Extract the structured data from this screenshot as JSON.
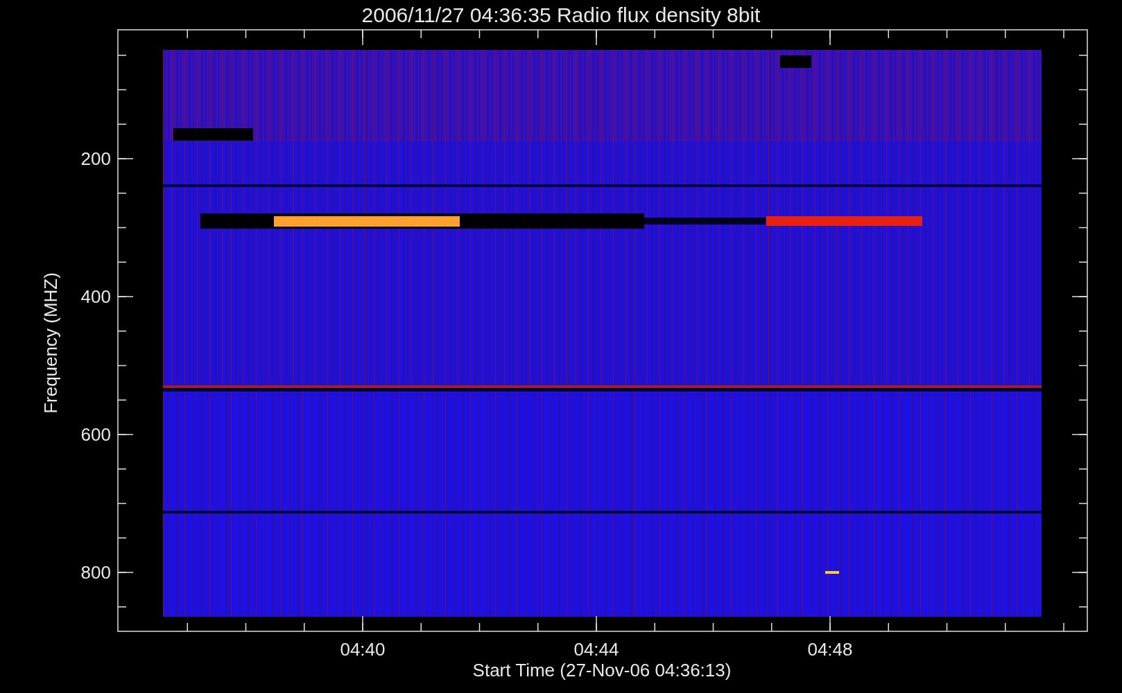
{
  "title": "2006/11/27 04:36:35 Radio flux density 8bit",
  "xlabel": "Start Time (27-Nov-06 04:36:13)",
  "ylabel": "Frequency (MHZ)",
  "yticks": [
    "200",
    "400",
    "600",
    "800"
  ],
  "xticks": [
    "04:40",
    "04:44",
    "04:48"
  ]
}
